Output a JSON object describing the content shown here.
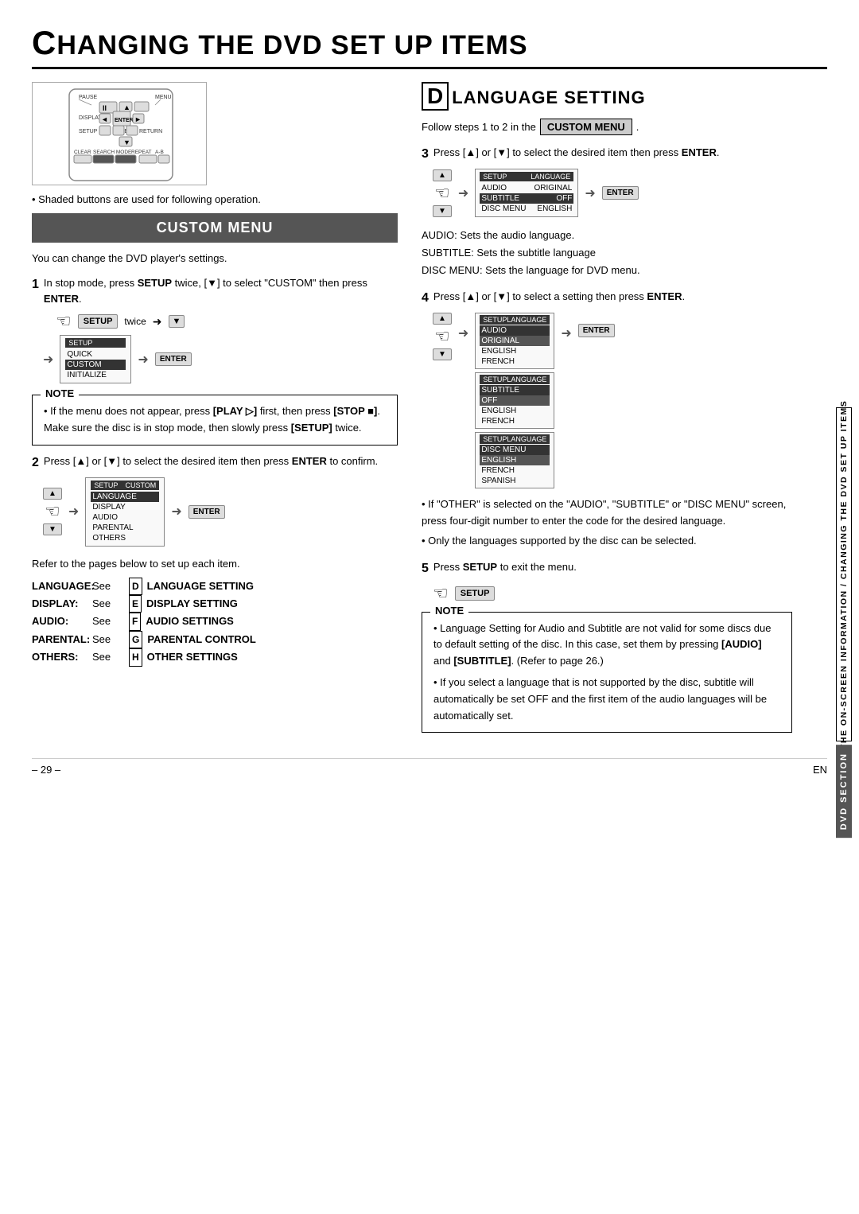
{
  "page": {
    "title_prefix": "C",
    "title_rest": "HANGING THE DVD SET UP ITEMS",
    "footer_page": "– 29 –",
    "footer_lang": "EN"
  },
  "left": {
    "bullet_note": "Shaded buttons are used for following operation.",
    "custom_menu_label": "CUSTOM MENU",
    "custom_menu_desc": "You can change the DVD player's settings.",
    "step1_num": "1",
    "step1_text": "In stop mode, press SETUP twice, [▼] to select \"CUSTOM\" then press ENTER.",
    "twice_label": "twice",
    "setup_label": "SETUP",
    "enter_label": "ENTER",
    "screen1_title_left": "SETUP",
    "screen1_rows": [
      "QUICK",
      "CUSTOM",
      "INITIALIZE"
    ],
    "screen1_highlighted": "CUSTOM",
    "note_title": "NOTE",
    "note_text1": "If the menu does not appear, press [PLAY ▷] first, then press [STOP ■]. Make sure the disc is in stop mode, then slowly press [SETUP] twice.",
    "step2_num": "2",
    "step2_text": "Press [▲] or [▼] to select the desired item then press ENTER to confirm.",
    "screen2_title_left": "SETUP",
    "screen2_title_right": "CUSTOM",
    "screen2_rows": [
      "LANGUAGE",
      "DISPLAY",
      "AUDIO",
      "PARENTAL",
      "OTHERS"
    ],
    "refer_text": "Refer to the pages below to set up each item.",
    "settings": [
      {
        "label": "LANGUAGE:",
        "see": "See",
        "badge": "D",
        "desc": "LANGUAGE SETTING"
      },
      {
        "label": "DISPLAY:",
        "see": "See",
        "badge": "E",
        "desc": "DISPLAY SETTING"
      },
      {
        "label": "AUDIO:",
        "see": "See",
        "badge": "F",
        "desc": "AUDIO SETTINGS"
      },
      {
        "label": "PARENTAL:",
        "see": "See",
        "badge": "G",
        "desc": "PARENTAL CONTROL"
      },
      {
        "label": "OTHERS:",
        "see": "See",
        "badge": "H",
        "desc": "OTHER SETTINGS"
      }
    ]
  },
  "right": {
    "section_letter": "D",
    "section_title": "LANGUAGE SETTING",
    "follow_text": "Follow steps 1 to 2 in the",
    "custom_menu_inline": "CUSTOM MENU",
    "step3_num": "3",
    "step3_text": "Press [▲] or [▼] to select the desired item then press ENTER.",
    "screen3_setup": "SETUP",
    "screen3_lang": "LANGUAGE",
    "screen3_rows": [
      {
        "label": "AUDIO",
        "value": "ORIGINAL"
      },
      {
        "label": "SUBTITLE",
        "value": "OFF"
      },
      {
        "label": "DISC MENU",
        "value": "ENGLISH"
      }
    ],
    "audio_note": "AUDIO: Sets the audio language.",
    "subtitle_note": "SUBTITLE: Sets the subtitle language",
    "discmenu_note": "DISC MENU: Sets the language for DVD menu.",
    "step4_num": "4",
    "step4_text": "Press [▲] or [▼] to select a setting then press ENTER.",
    "audio_screen_rows": [
      "ORIGINAL",
      "ENGLISH",
      "FRENCH"
    ],
    "subtitle_screen_rows": [
      "OFF",
      "ENGLISH",
      "FRENCH"
    ],
    "discmenu_screen_rows": [
      "ENGLISH",
      "FRENCH",
      "SPANISH"
    ],
    "bullet4_1": "If \"OTHER\" is selected on the \"AUDIO\", \"SUBTITLE\" or \"DISC MENU\" screen, press four-digit number to enter the code for the desired language.",
    "bullet4_2": "Only the languages supported by the disc can be selected.",
    "step5_num": "5",
    "step5_text": "Press SETUP to exit the menu.",
    "note2_title": "NOTE",
    "note2_bullets": [
      "Language Setting for Audio and Subtitle are not valid for some discs due to default setting of the disc. In this case, set them by pressing [AUDIO] and [SUBTITLE]. (Refer to page 26.)",
      "If you select a language that is not supported by the disc, subtitle will automatically be set OFF and the first item of the audio languages will be automatically set."
    ],
    "side_label1": "THE ON-SCREEN INFORMATION / CHANGING THE DVD SET UP ITEMS",
    "side_label2": "DVD SECTION"
  }
}
